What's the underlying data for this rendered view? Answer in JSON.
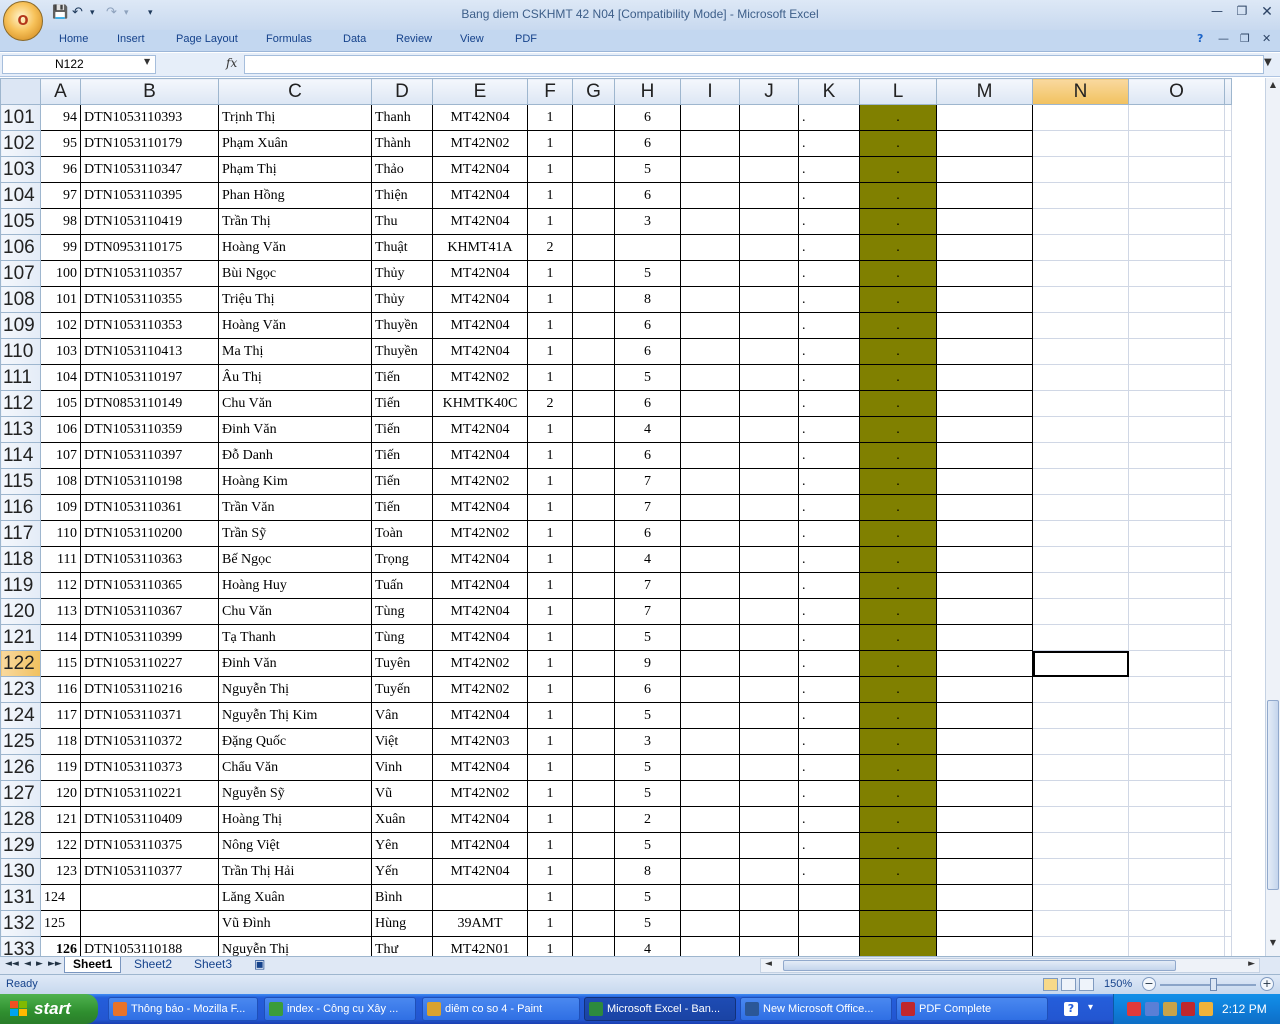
{
  "window": {
    "title": "Bang diem CSKHMT 42 N04  [Compatibility Mode] - Microsoft Excel",
    "office_button_label": "O"
  },
  "ribbon": {
    "tabs": [
      "Home",
      "Insert",
      "Page Layout",
      "Formulas",
      "Data",
      "Review",
      "View",
      "PDF"
    ]
  },
  "formula_bar": {
    "name_box": "N122",
    "fx_label": "fx",
    "formula": ""
  },
  "columns": [
    "A",
    "B",
    "C",
    "D",
    "E",
    "F",
    "G",
    "H",
    "I",
    "J",
    "K",
    "L",
    "M",
    "N",
    "O"
  ],
  "selected_column": "N",
  "selected_row": "122",
  "rows": [
    {
      "r": "101",
      "a": "94",
      "b": "DTN1053110393",
      "c": "Trịnh Thị",
      "d": "Thanh",
      "e": "MT42N04",
      "f": "1",
      "h": "6",
      "k": "."
    },
    {
      "r": "102",
      "a": "95",
      "b": "DTN1053110179",
      "c": "Phạm Xuân",
      "d": "Thành",
      "e": "MT42N02",
      "f": "1",
      "h": "6",
      "k": "."
    },
    {
      "r": "103",
      "a": "96",
      "b": "DTN1053110347",
      "c": "Phạm Thị",
      "d": "Thảo",
      "e": "MT42N04",
      "f": "1",
      "h": "5",
      "k": "."
    },
    {
      "r": "104",
      "a": "97",
      "b": "DTN1053110395",
      "c": "Phan Hồng",
      "d": "Thiện",
      "e": "MT42N04",
      "f": "1",
      "h": "6",
      "k": "."
    },
    {
      "r": "105",
      "a": "98",
      "b": "DTN1053110419",
      "c": "Trần Thị",
      "d": "Thu",
      "e": "MT42N04",
      "f": "1",
      "h": "3",
      "k": "."
    },
    {
      "r": "106",
      "a": "99",
      "b": "DTN0953110175",
      "c": "Hoàng Văn",
      "d": "Thuật",
      "e": "KHMT41A",
      "f": "2",
      "h": "",
      "k": "."
    },
    {
      "r": "107",
      "a": "100",
      "b": "DTN1053110357",
      "c": "Bùi Ngọc",
      "d": "Thủy",
      "e": "MT42N04",
      "f": "1",
      "h": "5",
      "k": "."
    },
    {
      "r": "108",
      "a": "101",
      "b": "DTN1053110355",
      "c": "Triệu Thị",
      "d": "Thủy",
      "e": "MT42N04",
      "f": "1",
      "h": "8",
      "k": "."
    },
    {
      "r": "109",
      "a": "102",
      "b": "DTN1053110353",
      "c": "Hoàng Văn",
      "d": "Thuyền",
      "e": "MT42N04",
      "f": "1",
      "h": "6",
      "k": "."
    },
    {
      "r": "110",
      "a": "103",
      "b": "DTN1053110413",
      "c": "Ma Thị",
      "d": "Thuyền",
      "e": "MT42N04",
      "f": "1",
      "h": "6",
      "k": "."
    },
    {
      "r": "111",
      "a": "104",
      "b": "DTN1053110197",
      "c": "Âu Thị",
      "d": "Tiến",
      "e": "MT42N02",
      "f": "1",
      "h": "5",
      "k": "."
    },
    {
      "r": "112",
      "a": "105",
      "b": "DTN0853110149",
      "c": "Chu Văn",
      "d": "Tiến",
      "e": "KHMTK40C",
      "f": "2",
      "h": "6",
      "k": "."
    },
    {
      "r": "113",
      "a": "106",
      "b": "DTN1053110359",
      "c": "Đinh Văn",
      "d": "Tiến",
      "e": "MT42N04",
      "f": "1",
      "h": "4",
      "k": "."
    },
    {
      "r": "114",
      "a": "107",
      "b": "DTN1053110397",
      "c": "Đỗ Danh",
      "d": "Tiến",
      "e": "MT42N04",
      "f": "1",
      "h": "6",
      "k": "."
    },
    {
      "r": "115",
      "a": "108",
      "b": "DTN1053110198",
      "c": "Hoàng Kim",
      "d": "Tiến",
      "e": "MT42N02",
      "f": "1",
      "h": "7",
      "k": "."
    },
    {
      "r": "116",
      "a": "109",
      "b": "DTN1053110361",
      "c": "Trần Văn",
      "d": "Tiến",
      "e": "MT42N04",
      "f": "1",
      "h": "7",
      "k": "."
    },
    {
      "r": "117",
      "a": "110",
      "b": "DTN1053110200",
      "c": "Trần Sỹ",
      "d": "Toàn",
      "e": "MT42N02",
      "f": "1",
      "h": "6",
      "k": "."
    },
    {
      "r": "118",
      "a": "111",
      "b": "DTN1053110363",
      "c": "Bế Ngọc",
      "d": "Trọng",
      "e": "MT42N04",
      "f": "1",
      "h": "4",
      "k": "."
    },
    {
      "r": "119",
      "a": "112",
      "b": "DTN1053110365",
      "c": "Hoàng Huy",
      "d": "Tuấn",
      "e": "MT42N04",
      "f": "1",
      "h": "7",
      "k": "."
    },
    {
      "r": "120",
      "a": "113",
      "b": "DTN1053110367",
      "c": "Chu Văn",
      "d": "Tùng",
      "e": "MT42N04",
      "f": "1",
      "h": "7",
      "k": "."
    },
    {
      "r": "121",
      "a": "114",
      "b": "DTN1053110399",
      "c": "Tạ Thanh",
      "d": "Tùng",
      "e": "MT42N04",
      "f": "1",
      "h": "5",
      "k": "."
    },
    {
      "r": "122",
      "a": "115",
      "b": "DTN1053110227",
      "c": "Đinh Văn",
      "d": "Tuyên",
      "e": "MT42N02",
      "f": "1",
      "h": "9",
      "k": "."
    },
    {
      "r": "123",
      "a": "116",
      "b": "DTN1053110216",
      "c": "Nguyễn Thị",
      "d": "Tuyến",
      "e": "MT42N02",
      "f": "1",
      "h": "6",
      "k": "."
    },
    {
      "r": "124",
      "a": "117",
      "b": "DTN1053110371",
      "c": "Nguyễn Thị Kim",
      "d": "Vân",
      "e": "MT42N04",
      "f": "1",
      "h": "5",
      "k": "."
    },
    {
      "r": "125",
      "a": "118",
      "b": "DTN1053110372",
      "c": "Đặng Quốc",
      "d": "Việt",
      "e": "MT42N03",
      "f": "1",
      "h": "3",
      "k": "."
    },
    {
      "r": "126",
      "a": "119",
      "b": "DTN1053110373",
      "c": "Chẩu Văn",
      "d": "Vinh",
      "e": "MT42N04",
      "f": "1",
      "h": "5",
      "k": "."
    },
    {
      "r": "127",
      "a": "120",
      "b": "DTN1053110221",
      "c": "Nguyễn Sỹ",
      "d": "Vũ",
      "e": "MT42N02",
      "f": "1",
      "h": "5",
      "k": "."
    },
    {
      "r": "128",
      "a": "121",
      "b": "DTN1053110409",
      "c": "Hoàng Thị",
      "d": "Xuân",
      "e": "MT42N04",
      "f": "1",
      "h": "2",
      "k": "."
    },
    {
      "r": "129",
      "a": "122",
      "b": "DTN1053110375",
      "c": "Nông Việt",
      "d": "Yên",
      "e": "MT42N04",
      "f": "1",
      "h": "5",
      "k": "."
    },
    {
      "r": "130",
      "a": "123",
      "b": "DTN1053110377",
      "c": "Trần Thị Hải",
      "d": "Yến",
      "e": "MT42N04",
      "f": "1",
      "h": "8",
      "k": "."
    },
    {
      "r": "131",
      "a": "124",
      "b": "",
      "c": "Lăng Xuân",
      "d": "Bình",
      "e": "",
      "f": "1",
      "h": "5",
      "k": "",
      "a_left": true
    },
    {
      "r": "132",
      "a": "125",
      "b": "",
      "c": "Vũ Đình",
      "d": "Hùng",
      "e": "39AMT",
      "f": "1",
      "h": "5",
      "k": "",
      "a_left": true
    },
    {
      "r": "133",
      "a": "126",
      "b": "DTN1053110188",
      "c": "Nguyễn Thị",
      "d": "Thư",
      "e": "MT42N01",
      "f": "1",
      "h": "4",
      "k": "",
      "a_bold": true
    }
  ],
  "sheet_tabs": [
    "Sheet1",
    "Sheet2",
    "Sheet3"
  ],
  "active_sheet": "Sheet1",
  "status": {
    "text": "Ready",
    "zoom": "150%"
  },
  "taskbar": {
    "start_label": "start",
    "buttons": [
      {
        "label": "Thông báo - Mozilla F...",
        "color": "#e8732a"
      },
      {
        "label": "index - Công cụ Xây ...",
        "color": "#3b9c3b"
      },
      {
        "label": "diêm co so 4 - Paint",
        "color": "#d9a22f"
      },
      {
        "label": "Microsoft Excel - Ban...",
        "color": "#2d8a3e"
      },
      {
        "label": "New Microsoft Office...",
        "color": "#2b5797"
      },
      {
        "label": "PDF Complete",
        "color": "#c0272d"
      }
    ],
    "clock": "2:12 PM"
  },
  "colors": {
    "olive_fill": "#808000",
    "selection_header": "#f1c15f"
  }
}
